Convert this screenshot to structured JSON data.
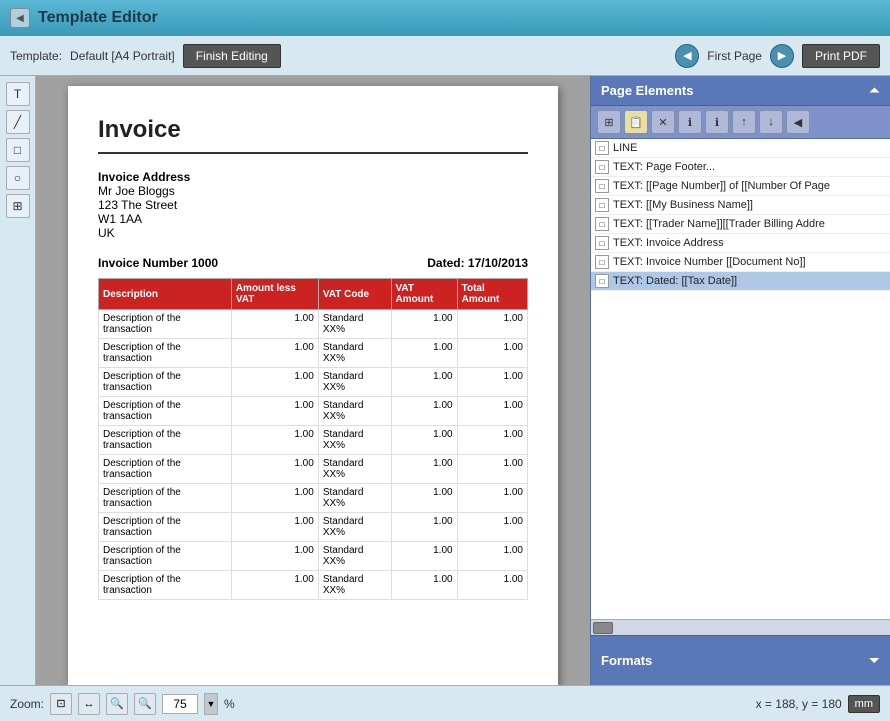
{
  "titleBar": {
    "title": "Template Editor"
  },
  "toolbar": {
    "templateLabel": "Template:",
    "templateValue": "Default [A4 Portrait]",
    "finishEditingLabel": "Finish Editing",
    "firstPageLabel": "First Page",
    "printPdfLabel": "Print PDF"
  },
  "leftTools": {
    "tools": [
      "T",
      "╱",
      "□",
      "○",
      "⊞"
    ]
  },
  "document": {
    "invoiceTitle": "Invoice",
    "addressLabel": "Invoice Address",
    "addressLine1": "Mr Joe Bloggs",
    "addressLine2": "123 The Street",
    "addressLine3": "W1 1AA",
    "addressLine4": "UK",
    "invoiceNumberLabel": "Invoice Number 1000",
    "datedLabel": "Dated: 17/10/2013",
    "tableHeaders": [
      "Description",
      "Amount less VAT",
      "VAT Code",
      "VAT Amount",
      "Total Amount"
    ],
    "tableRows": [
      [
        "Description of the transaction",
        "1.00",
        "Standard XX%",
        "1.00",
        "1.00"
      ],
      [
        "Description of the transaction",
        "1.00",
        "Standard XX%",
        "1.00",
        "1.00"
      ],
      [
        "Description of the transaction",
        "1.00",
        "Standard XX%",
        "1.00",
        "1.00"
      ],
      [
        "Description of the transaction",
        "1.00",
        "Standard XX%",
        "1.00",
        "1.00"
      ],
      [
        "Description of the transaction",
        "1.00",
        "Standard XX%",
        "1.00",
        "1.00"
      ],
      [
        "Description of the transaction",
        "1.00",
        "Standard XX%",
        "1.00",
        "1.00"
      ],
      [
        "Description of the transaction",
        "1.00",
        "Standard XX%",
        "1.00",
        "1.00"
      ],
      [
        "Description of the transaction",
        "1.00",
        "Standard XX%",
        "1.00",
        "1.00"
      ],
      [
        "Description of the transaction",
        "1.00",
        "Standard XX%",
        "1.00",
        "1.00"
      ],
      [
        "Description of the transaction",
        "1.00",
        "Standard XX%",
        "1.00",
        "1.00"
      ]
    ]
  },
  "pageElements": {
    "title": "Page Elements",
    "items": [
      {
        "label": "LINE"
      },
      {
        "label": "TEXT: Page Footer..."
      },
      {
        "label": "TEXT: [[Page Number]] of [[Number Of Page"
      },
      {
        "label": "TEXT: [[My Business Name]]"
      },
      {
        "label": "TEXT: [[Trader Name]][[Trader Billing Addre"
      },
      {
        "label": "TEXT: Invoice Address"
      },
      {
        "label": "TEXT: Invoice Number [[Document No]]"
      },
      {
        "label": "TEXT: Dated: [[Tax Date]]"
      }
    ],
    "selectedIndex": 7,
    "toolbarIcons": [
      "⊞",
      "📋",
      "✕",
      "ℹ",
      "ℹ",
      "↓",
      "↓",
      "◀"
    ]
  },
  "formats": {
    "title": "Formats"
  },
  "statusBar": {
    "zoomLabel": "Zoom:",
    "zoomValue": "75",
    "zoomPercent": "%",
    "coordinates": "x = 188, y = 180",
    "units": "mm"
  }
}
